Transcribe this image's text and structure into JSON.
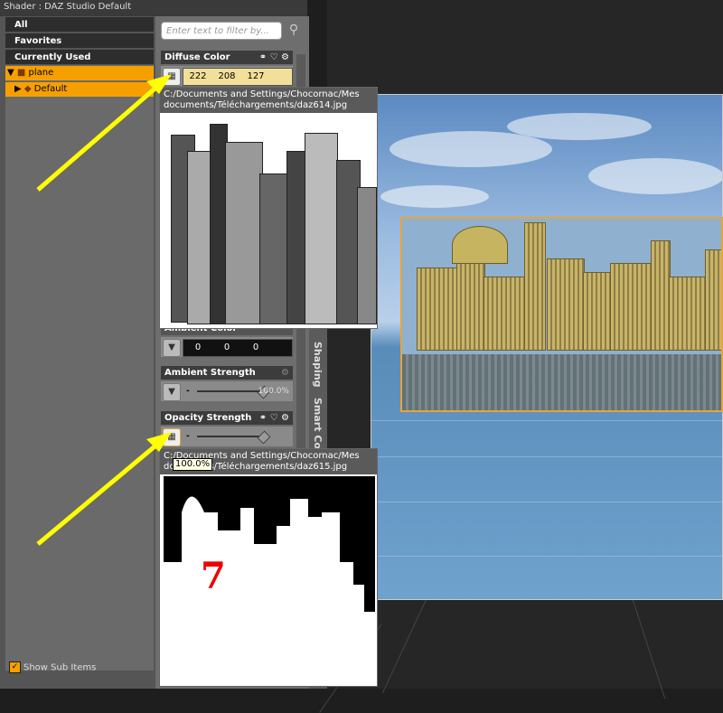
{
  "window": {
    "title": "Shader : DAZ Studio Default"
  },
  "categories": [
    "All",
    "Favorites",
    "Currently Used"
  ],
  "tree": {
    "items": [
      {
        "label": "plane"
      },
      {
        "label": "Default"
      }
    ]
  },
  "footer": {
    "show_sub_items_label": "Show Sub Items",
    "show_sub_items_checked": true
  },
  "filter": {
    "placeholder": "Enter text to filter by..."
  },
  "properties": {
    "diffuse": {
      "label": "Diffuse Color",
      "r": "222",
      "g": "208",
      "b": "127",
      "color": "#dec87f"
    },
    "ambient": {
      "label": "Ambient Color",
      "r": "0",
      "g": "0",
      "b": "0"
    },
    "ambient_strength": {
      "label": "Ambient Strength",
      "value": "100.0%",
      "level": 1.0
    },
    "opacity_strength": {
      "label": "Opacity Strength",
      "value": "100.0%",
      "level": 1.0
    }
  },
  "side_tabs": [
    "Shaping",
    "Smart Con"
  ],
  "popups": {
    "diffuse_map": {
      "path_line1": "C:/Documents and Settings/Chocornac/Mes",
      "path_line2": "documents/Téléchargements/daz614.jpg"
    },
    "opacity_map": {
      "path_line1": "C:/Documents and Settings/Chocornac/Mes",
      "path_line2": "documents/Téléchargements/daz615.jpg"
    }
  },
  "tooltip": {
    "text": "100.0%"
  },
  "annotation": {
    "label": "7",
    "color": "#e00000"
  },
  "arrow_color": "#ffff00"
}
